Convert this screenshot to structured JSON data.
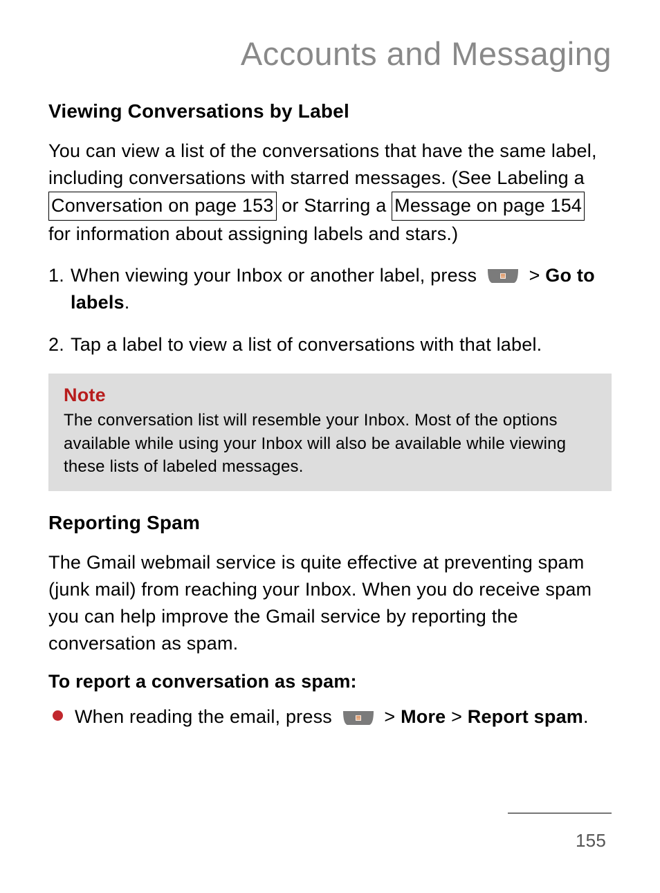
{
  "chapter_title": "Accounts and Messaging",
  "section1": {
    "heading": "Viewing Conversations by Label",
    "para_parts": {
      "t1": "You can view a list of the conversations that have the same label, including conversations with starred messages. (See Labeling a ",
      "link1": "Conversation on page 153",
      "t2": " or Starring a ",
      "link2": "Message on page 154",
      "t3": " for information about assigning labels and stars.)"
    },
    "steps": {
      "s1_a": "When viewing your Inbox or another label, press ",
      "s1_gt": ">",
      "s1_goto": " Go to labels",
      "s1_period": ".",
      "s2": "Tap a label to view a list of conversations with that label."
    }
  },
  "note": {
    "title": "Note",
    "body": "The conversation list will resemble your Inbox. Most of the options available while using your Inbox will also be available while viewing these lists of labeled messages."
  },
  "section2": {
    "heading": "Reporting Spam",
    "para": "The Gmail webmail service is quite effective at preventing spam (junk mail) from reaching your Inbox. When you do receive spam you can help improve the Gmail service by reporting the conversation as spam.",
    "subheading": "To report a conversation as spam:",
    "bullet": {
      "a": "When reading the email, press ",
      "gt1": ">",
      "more": " More ",
      "gt2": ">",
      "report": " Report spam",
      "period": "."
    }
  },
  "page_number": "155"
}
